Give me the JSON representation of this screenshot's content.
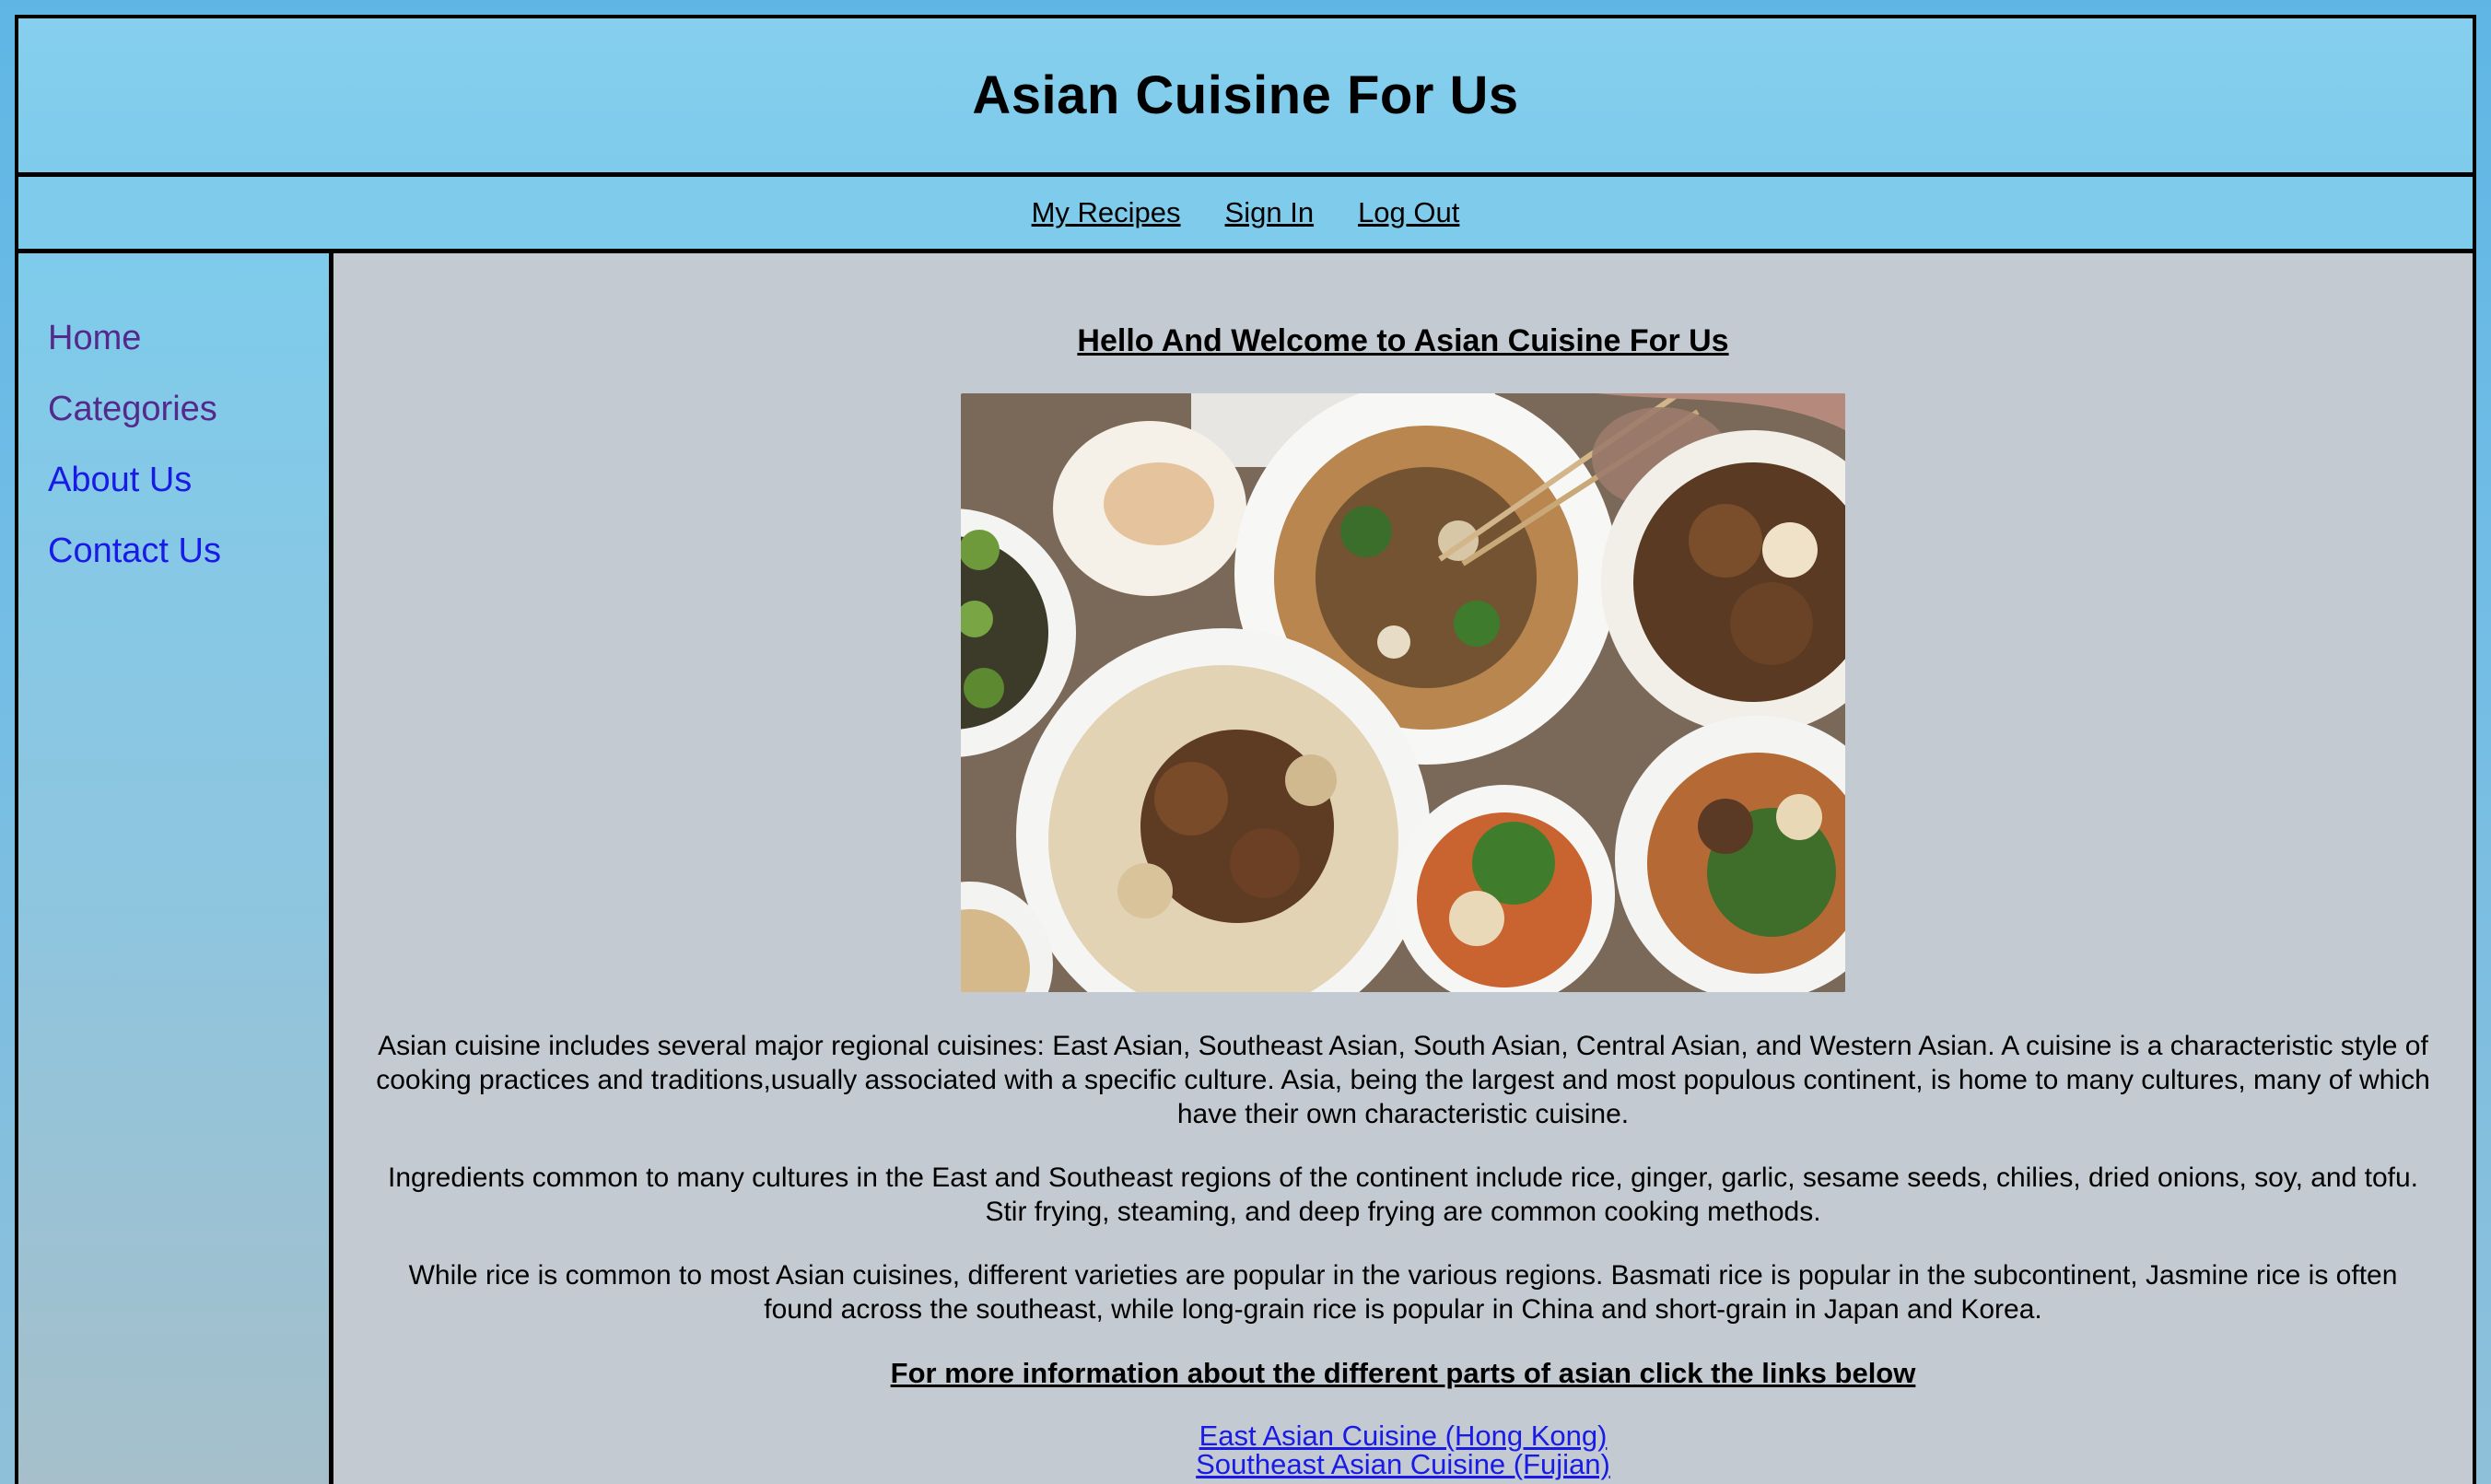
{
  "header": {
    "title": "Asian Cuisine For Us"
  },
  "topnav": {
    "links": [
      {
        "label": "My Recipes"
      },
      {
        "label": "Sign In"
      },
      {
        "label": "Log Out"
      }
    ]
  },
  "sidebar": {
    "items": [
      {
        "label": "Home",
        "color": "#55298c"
      },
      {
        "label": "Categories",
        "color": "#55298c"
      },
      {
        "label": "About Us",
        "color": "#1a1ae6"
      },
      {
        "label": "Contact Us",
        "color": "#1a1ae6"
      }
    ]
  },
  "main": {
    "heading": "Hello And Welcome to Asian Cuisine For Us",
    "paragraphs": [
      "Asian cuisine includes several major regional cuisines: East Asian, Southeast Asian, South Asian, Central Asian, and Western Asian. A cuisine is a characteristic style of cooking practices and traditions,usually associated with a specific culture. Asia, being the largest and most populous continent, is home to many cultures, many of which have their own characteristic cuisine.",
      "Ingredients common to many cultures in the East and Southeast regions of the continent include rice, ginger, garlic, sesame seeds, chilies, dried onions, soy, and tofu. Stir frying, steaming, and deep frying are common cooking methods.",
      "While rice is common to most Asian cuisines, different varieties are popular in the various regions. Basmati rice is popular in the subcontinent, Jasmine rice is often found across the southeast, while long-grain rice is popular in China and short-grain in Japan and Korea."
    ],
    "more_info": "For more information about the different parts of asian click the links below",
    "region_links": [
      {
        "label": "East Asian Cuisine (Hong Kong)"
      },
      {
        "label": "Southeast Asian Cuisine (Fujian)"
      }
    ]
  }
}
